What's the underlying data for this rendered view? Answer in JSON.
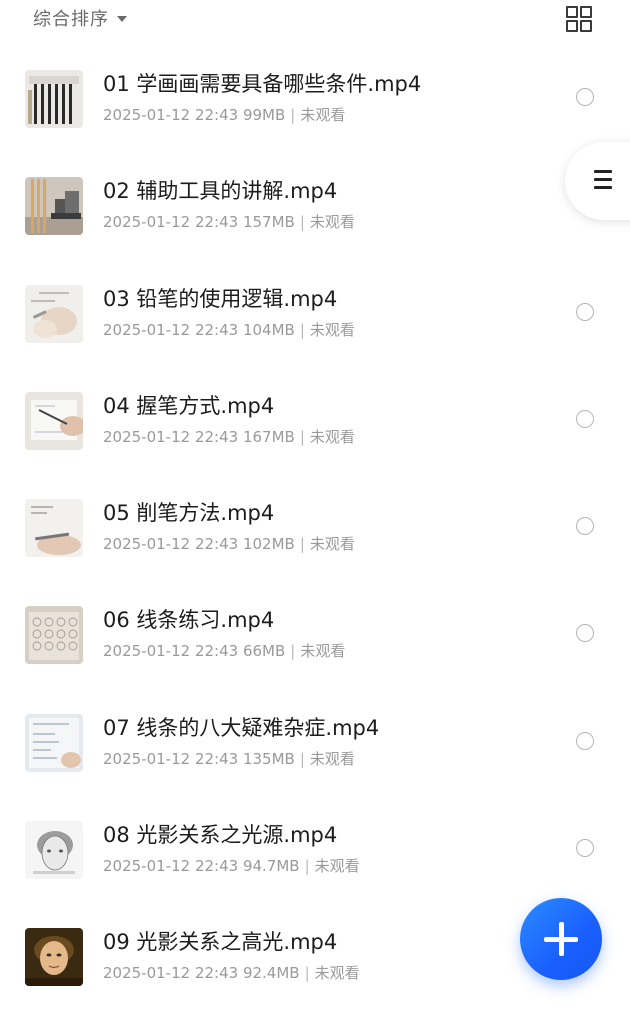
{
  "toolbar": {
    "sort_label": "综合排序"
  },
  "files": [
    {
      "title": "01 学画画需要具备哪些条件.mp4",
      "date": "2025-01-12 22:43",
      "size": "99MB",
      "status": "未观看",
      "thumb_icon": "pencils-thumbnail"
    },
    {
      "title": "02 辅助工具的讲解.mp4",
      "date": "2025-01-12 22:43",
      "size": "157MB",
      "status": "未观看",
      "thumb_icon": "easel-thumbnail"
    },
    {
      "title": "03 铅笔的使用逻辑.mp4",
      "date": "2025-01-12 22:43",
      "size": "104MB",
      "status": "未观看",
      "thumb_icon": "hand-paper-thumbnail"
    },
    {
      "title": "04 握笔方式.mp4",
      "date": "2025-01-12 22:43",
      "size": "167MB",
      "status": "未观看",
      "thumb_icon": "hand-pencil-thumbnail"
    },
    {
      "title": "05 削笔方法.mp4",
      "date": "2025-01-12 22:43",
      "size": "102MB",
      "status": "未观看",
      "thumb_icon": "sharpening-thumbnail"
    },
    {
      "title": "06 线条练习.mp4",
      "date": "2025-01-12 22:43",
      "size": "66MB",
      "status": "未观看",
      "thumb_icon": "line-practice-thumbnail"
    },
    {
      "title": "07 线条的八大疑难杂症.mp4",
      "date": "2025-01-12 22:43",
      "size": "135MB",
      "status": "未观看",
      "thumb_icon": "line-notes-thumbnail"
    },
    {
      "title": "08 光影关系之光源.mp4",
      "date": "2025-01-12 22:43",
      "size": "94.7MB",
      "status": "未观看",
      "thumb_icon": "sketch-head-thumbnail"
    },
    {
      "title": "09 光影关系之高光.mp4",
      "date": "2025-01-12 22:43",
      "size": "92.4MB",
      "status": "未观看",
      "thumb_icon": "portrait-painting-thumbnail"
    }
  ],
  "colors": {
    "fab_accent": "#1a5fff",
    "meta_text": "#9a9a9a"
  }
}
